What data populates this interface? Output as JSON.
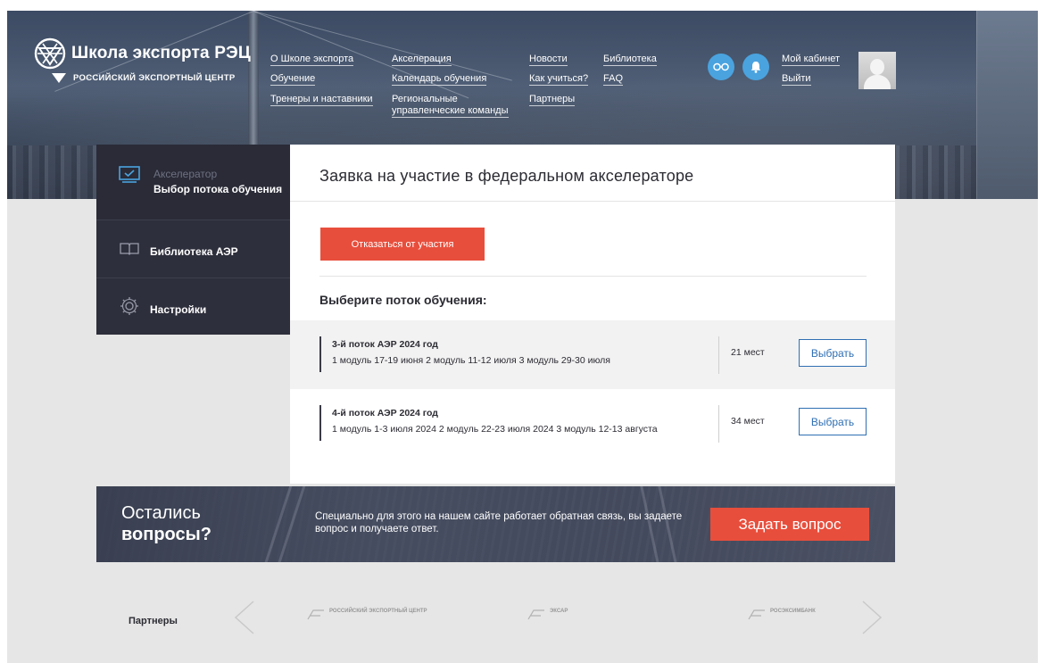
{
  "logo": {
    "title": "Школа экспорта РЭЦ",
    "subtitle": "РОССИЙСКИЙ ЭКСПОРТНЫЙ ЦЕНТР"
  },
  "nav": {
    "items": [
      "О Школе экспорта",
      "Обучение",
      "Тренеры и наставники",
      "Акселерация",
      "Календарь обучения",
      "Региональные",
      "управленческие команды",
      "Новости",
      "Как учиться?",
      "Партнеры",
      "Библиотека",
      "FAQ"
    ],
    "cabinet": "Мой кабинет",
    "logout": "Выйти"
  },
  "sidebar": {
    "items": [
      {
        "label": "Акселератор",
        "sub": "Выбор потока обучения"
      },
      {
        "label": "Библиотека АЭР"
      },
      {
        "label": "Настройки"
      }
    ]
  },
  "main": {
    "title": "Заявка на участие в федеральном акселераторе",
    "decline_label": "Отказаться от участия",
    "choose_title": "Выберите поток обучения:",
    "streams": [
      {
        "name": "3-й поток АЭР 2024 год",
        "dates": "1 модуль 17-19 июня 2 модуль 11-12 июля 3 модуль 29-30 июля",
        "seats": "21 мест",
        "action": "Выбрать"
      },
      {
        "name": "4-й поток АЭР 2024 год",
        "dates": "1 модуль 1-3 июля 2024 2 модуль 22-23 июля 2024 3 модуль 12-13 августа",
        "seats": "34 мест",
        "action": "Выбрать"
      }
    ]
  },
  "questions": {
    "line1": "Остались",
    "line2": "вопросы?",
    "text": "Специально для этого на нашем сайте работает обратная связь, вы задаете вопрос и получаете ответ.",
    "button": "Задать вопрос"
  },
  "partners": {
    "label": "Партнеры",
    "logos": [
      {
        "line1": "РОССИЙСКИЙ ЭКСПОРТНЫЙ ЦЕНТР"
      },
      {
        "line1": "ЭКСАР"
      },
      {
        "line1": "РОСЭКСИМБАНК"
      }
    ]
  },
  "colors": {
    "accent_red": "#e84e3c",
    "accent_blue": "#4aa3df",
    "sidebar_bg": "#2e2f3c",
    "link_blue": "#2f6fb3"
  }
}
